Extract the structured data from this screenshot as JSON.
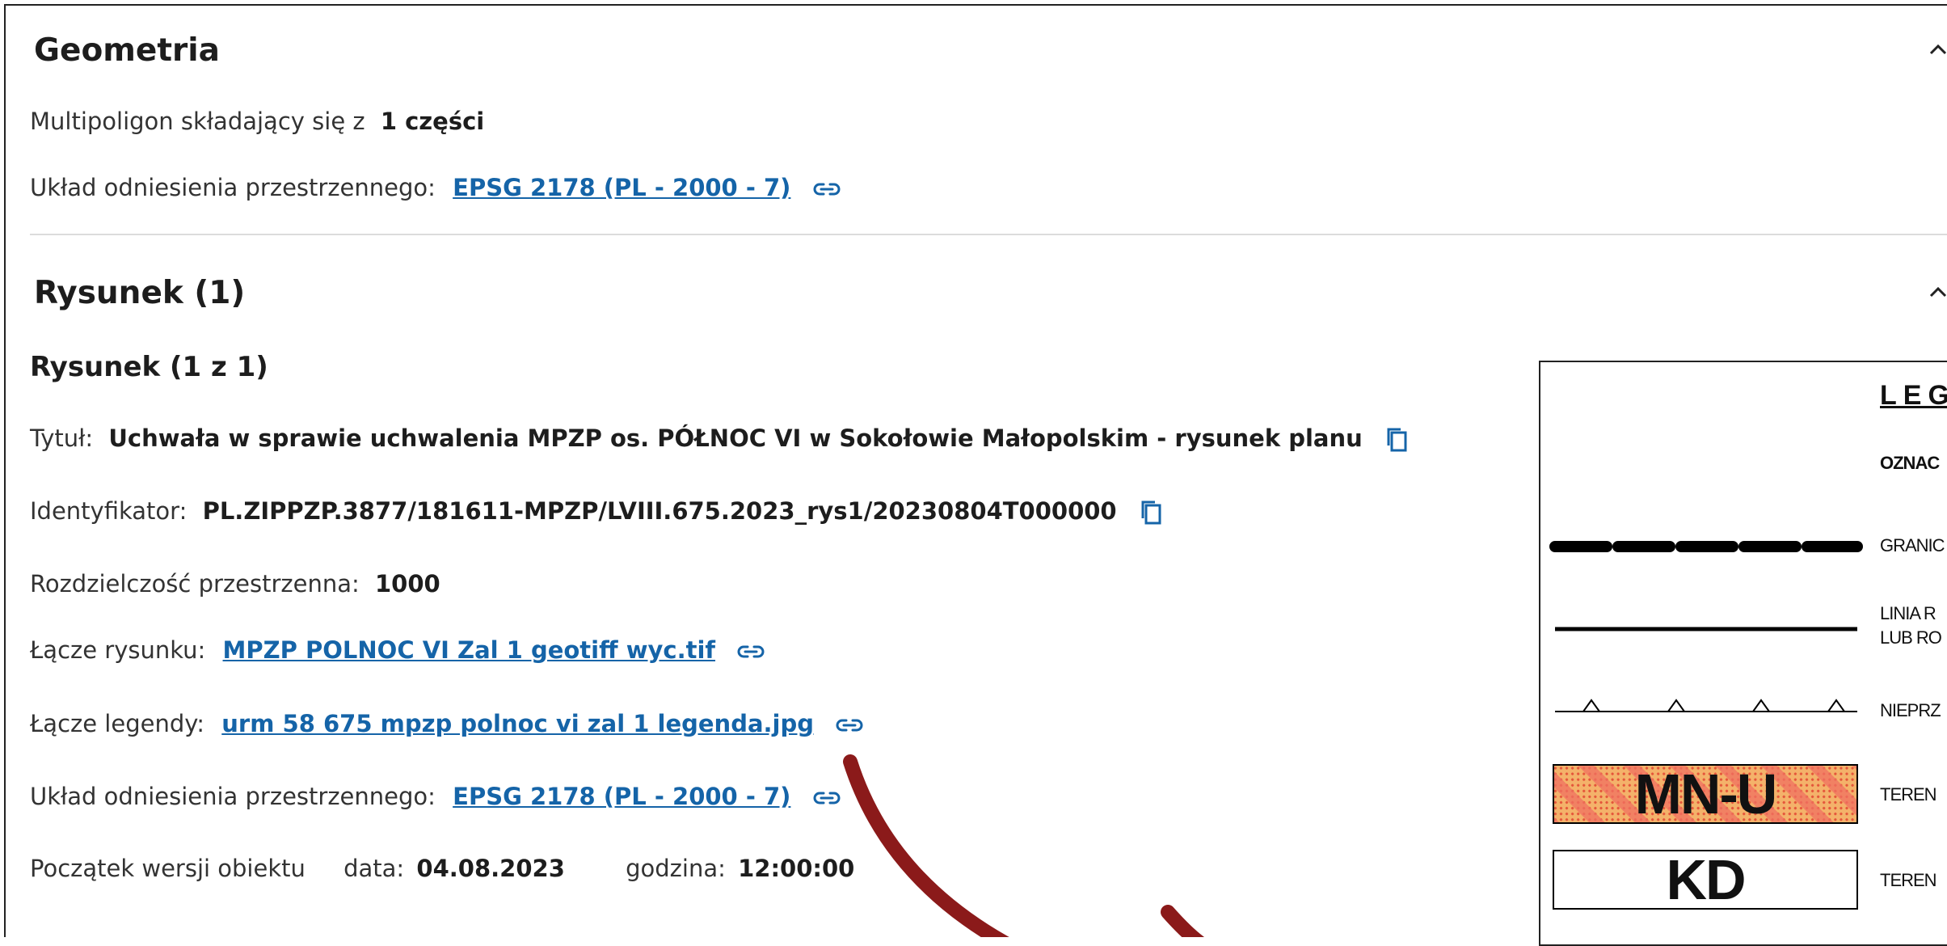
{
  "geometria": {
    "title": "Geometria",
    "multipolygon_label": "Multipoligon składający się z",
    "multipolygon_value": "1 części",
    "crs_label": "Układ odniesienia przestrzennego:",
    "crs_link": "EPSG 2178 (PL - 2000 - 7)"
  },
  "rysunek": {
    "title": "Rysunek (1)",
    "subtitle": "Rysunek (1 z 1)",
    "title_label": "Tytuł:",
    "title_value": "Uchwała w sprawie uchwalenia MPZP os. PÓŁNOC VI w Sokołowie Małopolskim - rysunek planu",
    "id_label": "Identyfikator:",
    "id_value": "PL.ZIPPZP.3877/181611-MPZP/LVIII.675.2023_rys1/20230804T000000",
    "resolution_label": "Rozdzielczość przestrzenna:",
    "resolution_value": "1000",
    "drawing_link_label": "Łącze rysunku:",
    "drawing_link": "MPZP POLNOC VI Zal 1 geotiff wyc.tif",
    "legend_link_label": "Łącze legendy:",
    "legend_link": "urm 58 675 mpzp polnoc vi zal 1 legenda.jpg",
    "crs_label": "Układ odniesienia przestrzennego:",
    "crs_link": "EPSG 2178 (PL - 2000 - 7)",
    "version_label": "Początek wersji obiektu",
    "date_label": "data:",
    "date_value": "04.08.2023",
    "time_label": "godzina:",
    "time_value": "12:00:00"
  },
  "legend_preview": {
    "heading": "LEG",
    "oznac": "OZNAC",
    "line1": "GRANIC",
    "line2a": "LINIA R",
    "line2b": "LUB RO",
    "line3": "NIEPRZ",
    "box1_label": "MN-U",
    "box1_text": "TEREN",
    "box2_label": "KD",
    "box2_text": "TEREN"
  },
  "colors": {
    "link": "#1564a8",
    "arrow": "#8b1a1a",
    "mnu_fill": "#f2a65a",
    "mnu_dots": "#e85d3a"
  },
  "icons": [
    "chevron-up-icon",
    "link-icon",
    "copy-icon"
  ]
}
